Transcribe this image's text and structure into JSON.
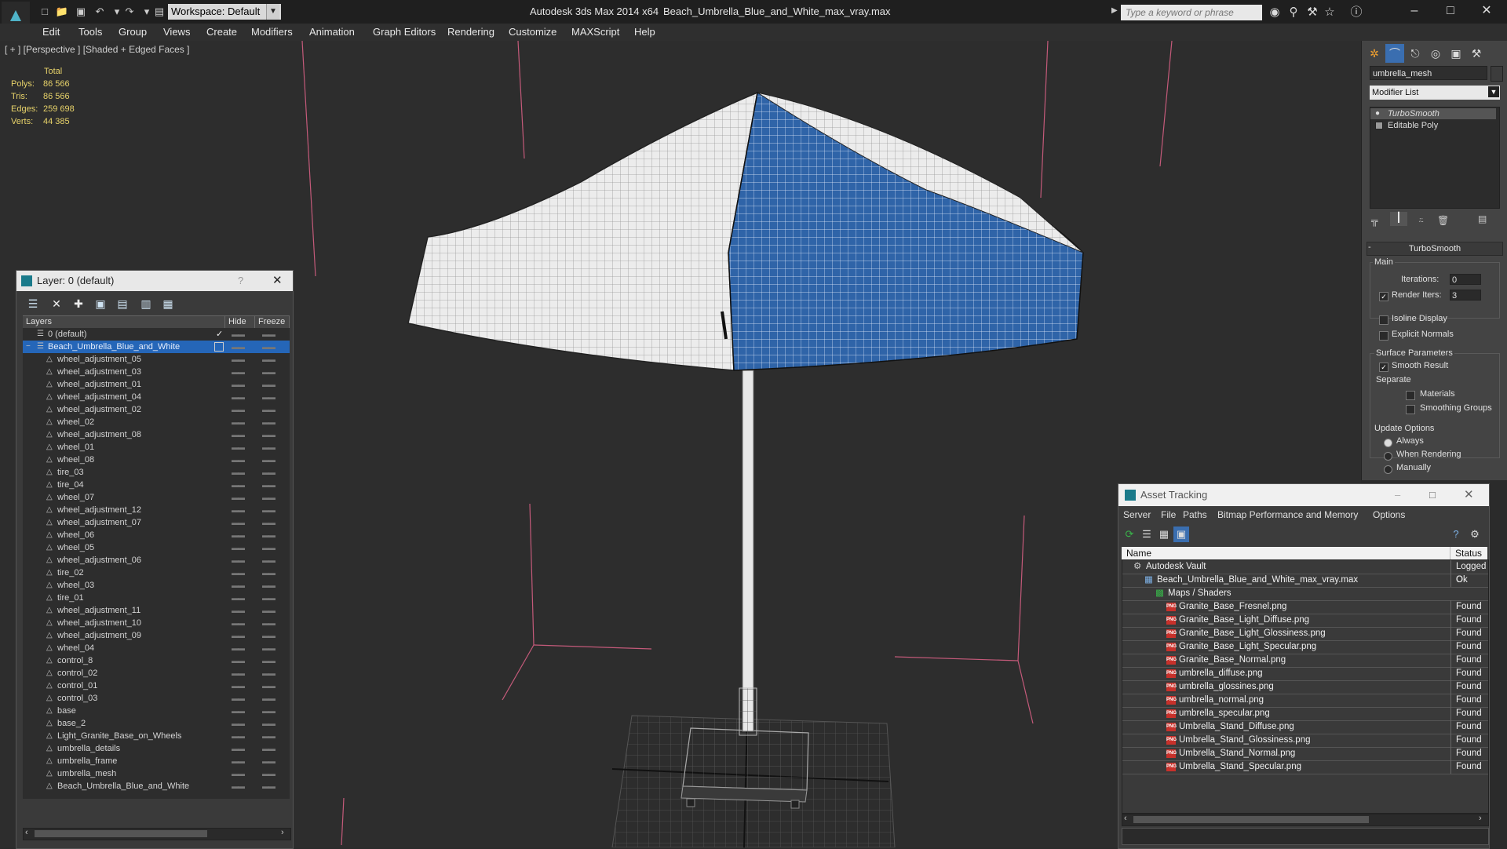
{
  "titlebar": {
    "workspace": "Workspace: Default",
    "app_title": "Autodesk 3ds Max  2014 x64",
    "file_title": "Beach_Umbrella_Blue_and_White_max_vray.max",
    "search_placeholder": "Type a keyword or phrase"
  },
  "menu": [
    "Edit",
    "Tools",
    "Group",
    "Views",
    "Create",
    "Modifiers",
    "Animation",
    "Graph Editors",
    "Rendering",
    "Customize",
    "MAXScript",
    "Help"
  ],
  "viewport": {
    "label": "[ + ] [Perspective ] [Shaded + Edged Faces ]",
    "stats_header": "Total",
    "stats": [
      {
        "k": "Polys:",
        "v": "86 566"
      },
      {
        "k": "Tris:",
        "v": "86 566"
      },
      {
        "k": "Edges:",
        "v": "259 698"
      },
      {
        "k": "Verts:",
        "v": "44 385"
      }
    ],
    "colors": {
      "canopy_blue": "#2f64a8",
      "canopy_white": "#e8e8e8",
      "grid": "#555555",
      "pink_line": "#c45a7a"
    }
  },
  "command_panel": {
    "object_name": "umbrella_mesh",
    "modifier_list": "Modifier List",
    "stack": [
      "TurboSmooth",
      "Editable Poly"
    ],
    "rollout_title": "TurboSmooth",
    "main_label": "Main",
    "iterations_label": "Iterations:",
    "iterations_value": "0",
    "render_iters_label": "Render Iters:",
    "render_iters_value": "3",
    "isoline": "Isoline Display",
    "explicit_normals": "Explicit Normals",
    "surface_params": "Surface Parameters",
    "smooth_result": "Smooth Result",
    "separate": "Separate",
    "materials": "Materials",
    "smoothing_groups": "Smoothing Groups",
    "update_options": "Update Options",
    "always": "Always",
    "when_rendering": "When Rendering",
    "manually": "Manually"
  },
  "layer_dialog": {
    "title": "Layer: 0 (default)",
    "help": "?",
    "col_layers": "Layers",
    "col_hide": "Hide",
    "col_freeze": "Freeze",
    "default_layer": "0 (default)",
    "selected_layer": "Beach_Umbrella_Blue_and_White",
    "objects": [
      "wheel_adjustment_05",
      "wheel_adjustment_03",
      "wheel_adjustment_01",
      "wheel_adjustment_04",
      "wheel_adjustment_02",
      "wheel_02",
      "wheel_adjustment_08",
      "wheel_01",
      "wheel_08",
      "tire_03",
      "tire_04",
      "wheel_07",
      "wheel_adjustment_12",
      "wheel_adjustment_07",
      "wheel_06",
      "wheel_05",
      "wheel_adjustment_06",
      "tire_02",
      "wheel_03",
      "tire_01",
      "wheel_adjustment_11",
      "wheel_adjustment_10",
      "wheel_adjustment_09",
      "wheel_04",
      "control_8",
      "control_02",
      "control_01",
      "control_03",
      "base",
      "base_2",
      "Light_Granite_Base_on_Wheels",
      "umbrella_details",
      "umbrella_frame",
      "umbrella_mesh",
      "Beach_Umbrella_Blue_and_White"
    ]
  },
  "asset_tracking": {
    "title": "Asset Tracking",
    "menu": [
      "Server",
      "File",
      "Paths",
      "Bitmap Performance and Memory",
      "Options"
    ],
    "col_name": "Name",
    "col_status": "Status",
    "rows": [
      {
        "name": "Autodesk Vault",
        "status": "Logged O",
        "indent": 0,
        "kind": "vault"
      },
      {
        "name": "Beach_Umbrella_Blue_and_White_max_vray.max",
        "status": "Ok",
        "indent": 1,
        "kind": "max"
      },
      {
        "name": "Maps / Shaders",
        "status": "",
        "indent": 2,
        "kind": "folder"
      },
      {
        "name": "Granite_Base_Fresnel.png",
        "status": "Found",
        "indent": 3,
        "kind": "png"
      },
      {
        "name": "Granite_Base_Light_Diffuse.png",
        "status": "Found",
        "indent": 3,
        "kind": "png"
      },
      {
        "name": "Granite_Base_Light_Glossiness.png",
        "status": "Found",
        "indent": 3,
        "kind": "png"
      },
      {
        "name": "Granite_Base_Light_Specular.png",
        "status": "Found",
        "indent": 3,
        "kind": "png"
      },
      {
        "name": "Granite_Base_Normal.png",
        "status": "Found",
        "indent": 3,
        "kind": "png"
      },
      {
        "name": "umbrella_diffuse.png",
        "status": "Found",
        "indent": 3,
        "kind": "png"
      },
      {
        "name": "umbrella_glossines.png",
        "status": "Found",
        "indent": 3,
        "kind": "png"
      },
      {
        "name": "umbrella_normal.png",
        "status": "Found",
        "indent": 3,
        "kind": "png"
      },
      {
        "name": "umbrella_specular.png",
        "status": "Found",
        "indent": 3,
        "kind": "png"
      },
      {
        "name": "Umbrella_Stand_Diffuse.png",
        "status": "Found",
        "indent": 3,
        "kind": "png"
      },
      {
        "name": "Umbrella_Stand_Glossiness.png",
        "status": "Found",
        "indent": 3,
        "kind": "png"
      },
      {
        "name": "Umbrella_Stand_Normal.png",
        "status": "Found",
        "indent": 3,
        "kind": "png"
      },
      {
        "name": "Umbrella_Stand_Specular.png",
        "status": "Found",
        "indent": 3,
        "kind": "png"
      }
    ]
  }
}
